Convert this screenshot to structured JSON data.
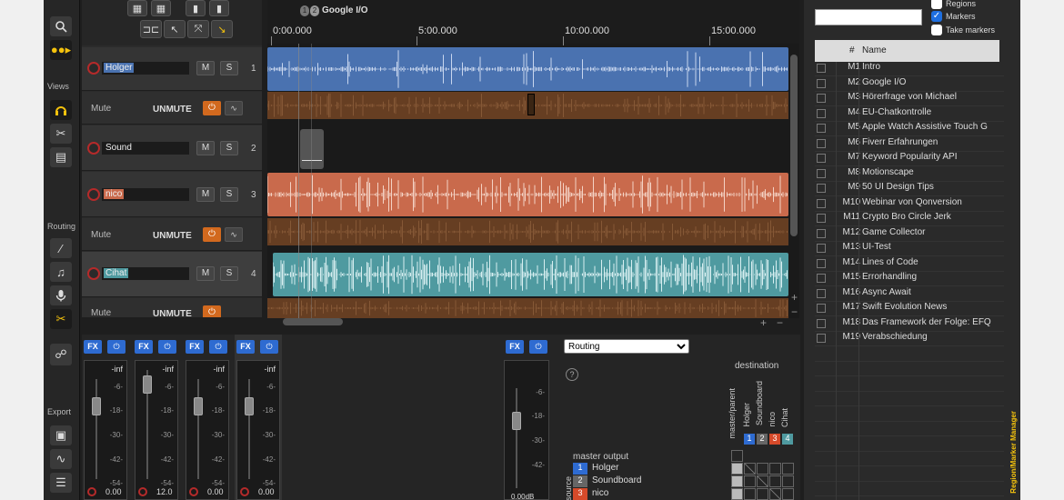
{
  "colors": {
    "holger": "#4a72b0",
    "nico": "#c96a4c",
    "cihat": "#4f9aa0",
    "envelope": "#7a4724"
  },
  "left": {
    "views_label": "Views",
    "routing_label": "Routing",
    "export_label": "Export"
  },
  "tracks": [
    {
      "name": "Holger",
      "num": "1",
      "mute": "M",
      "solo": "S"
    },
    {
      "name": "Sound",
      "num": "2",
      "mute": "M",
      "solo": "S"
    },
    {
      "name": "nico",
      "num": "3",
      "mute": "M",
      "solo": "S"
    },
    {
      "name": "Cihat",
      "num": "4",
      "mute": "M",
      "solo": "S"
    }
  ],
  "envelope": {
    "name": "Mute",
    "value": "UNMUTE"
  },
  "ruler": {
    "labels": [
      "0:00.000",
      "5:00.000",
      "10:00.000",
      "15:00.000"
    ],
    "marker_label": "Google I/O",
    "marker_badges": [
      "1",
      "2"
    ]
  },
  "mixer": {
    "fx": "FX",
    "strips": [
      {
        "db_top": "-inf",
        "vol": "0.00"
      },
      {
        "db_top": "-inf",
        "vol": "12.0"
      },
      {
        "db_top": "-inf",
        "vol": "0.00"
      },
      {
        "db_top": "-inf",
        "vol": "0.00"
      }
    ],
    "scale": [
      "-6-",
      "-18-",
      "-30-",
      "-42-",
      "-54-"
    ],
    "master_scale": [
      "-6-",
      "-18-",
      "-30-",
      "-42-"
    ],
    "master_vol": "0.00dB"
  },
  "routing": {
    "select_value": "Routing",
    "help": "?",
    "destination": "destination",
    "master_output": "master output",
    "source": "source",
    "dest_cols": [
      "master/parent",
      "Holger",
      "Soundboard",
      "nico",
      "Cihat"
    ],
    "dest_nums": [
      "1",
      "2",
      "3",
      "4"
    ],
    "sources": [
      {
        "num": "1",
        "name": "Holger"
      },
      {
        "num": "2",
        "name": "Soundboard"
      },
      {
        "num": "3",
        "name": "nico"
      }
    ]
  },
  "markers": {
    "search_value": "",
    "options": [
      {
        "label": "Regions",
        "checked": false
      },
      {
        "label": "Markers",
        "checked": true
      },
      {
        "label": "Take markers",
        "checked": false
      }
    ],
    "col_num": "#",
    "col_name": "Name",
    "panel_title": "Region/Marker Manager",
    "items": [
      {
        "id": "M1",
        "name": "Intro"
      },
      {
        "id": "M2",
        "name": "Google I/O"
      },
      {
        "id": "M3",
        "name": "Hörerfrage von Michael"
      },
      {
        "id": "M4",
        "name": "EU-Chatkontrolle"
      },
      {
        "id": "M5",
        "name": "Apple Watch Assistive Touch G"
      },
      {
        "id": "M6",
        "name": "Fiverr Erfahrungen"
      },
      {
        "id": "M7",
        "name": "Keyword Popularity API"
      },
      {
        "id": "M8",
        "name": "Motionscape"
      },
      {
        "id": "M9",
        "name": "50 UI Design Tips"
      },
      {
        "id": "M10",
        "name": "Webinar von Qonversion"
      },
      {
        "id": "M11",
        "name": "Crypto Bro Circle Jerk"
      },
      {
        "id": "M12",
        "name": "Game Collector"
      },
      {
        "id": "M13",
        "name": "UI-Test"
      },
      {
        "id": "M14",
        "name": "Lines of Code"
      },
      {
        "id": "M15",
        "name": "Errorhandling"
      },
      {
        "id": "M16",
        "name": "Async Await"
      },
      {
        "id": "M17",
        "name": "Swift Evolution News"
      },
      {
        "id": "M18",
        "name": "Das Framework der Folge: EFQ"
      },
      {
        "id": "M19",
        "name": "Verabschiedung"
      }
    ]
  }
}
